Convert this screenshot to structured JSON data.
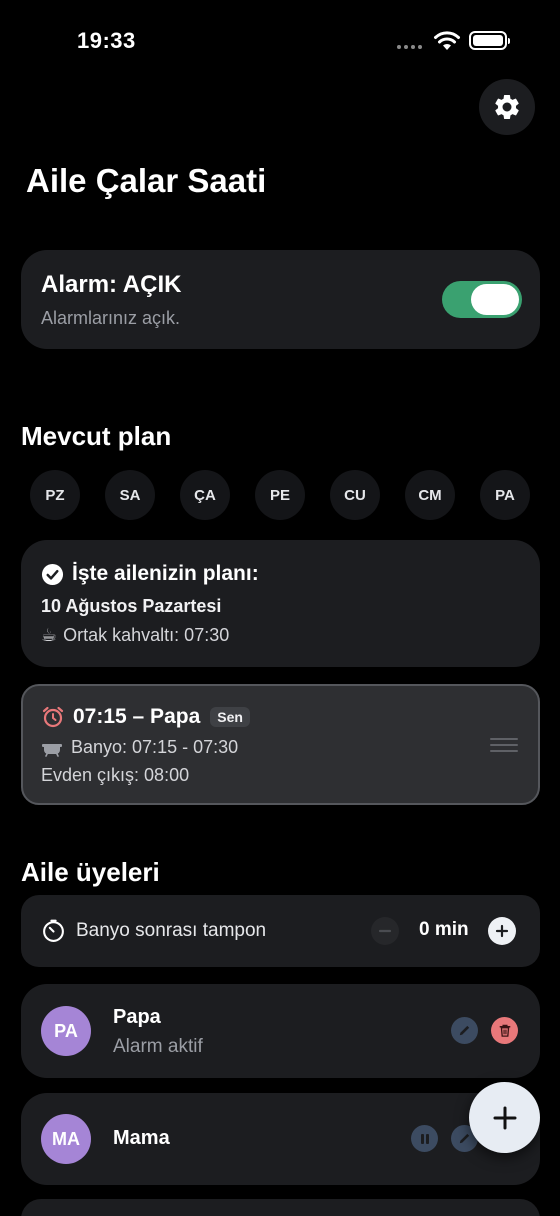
{
  "status_bar": {
    "time": "19:33"
  },
  "header": {
    "title": "Aile Çalar Saati",
    "settings_icon": "gear-icon"
  },
  "alarm": {
    "title": "Alarm: AÇIK",
    "subtitle": "Alarmlarınız açık.",
    "enabled": true,
    "toggle_color": "#3aa170"
  },
  "plan_section": {
    "title": "Mevcut plan",
    "days": [
      "PZ",
      "SA",
      "ÇA",
      "PE",
      "CU",
      "CM",
      "PA"
    ]
  },
  "plan_card": {
    "heading": "İşte ailenizin planı:",
    "date": "10 Ağustos Pazartesi",
    "breakfast_icon": "☕",
    "breakfast": "Ortak kahvaltı: 07:30"
  },
  "papa_plan": {
    "title": "07:15 – Papa",
    "badge": "Sen",
    "bath": "Banyo: 07:15 - 07:30",
    "leave": "Evden çıkış: 08:00"
  },
  "members_section": {
    "title": "Aile üyeleri"
  },
  "buffer": {
    "label": "Banyo sonrası tampon",
    "value": "0 min"
  },
  "members": [
    {
      "initials": "PA",
      "name": "Papa",
      "status": "Alarm aktif"
    },
    {
      "initials": "MA",
      "name": "Mama"
    }
  ],
  "colors": {
    "background": "#000000",
    "card": "#1c1d20",
    "avatar": "#a585d6",
    "delete": "#e8787a",
    "accent_green": "#3aa170"
  }
}
